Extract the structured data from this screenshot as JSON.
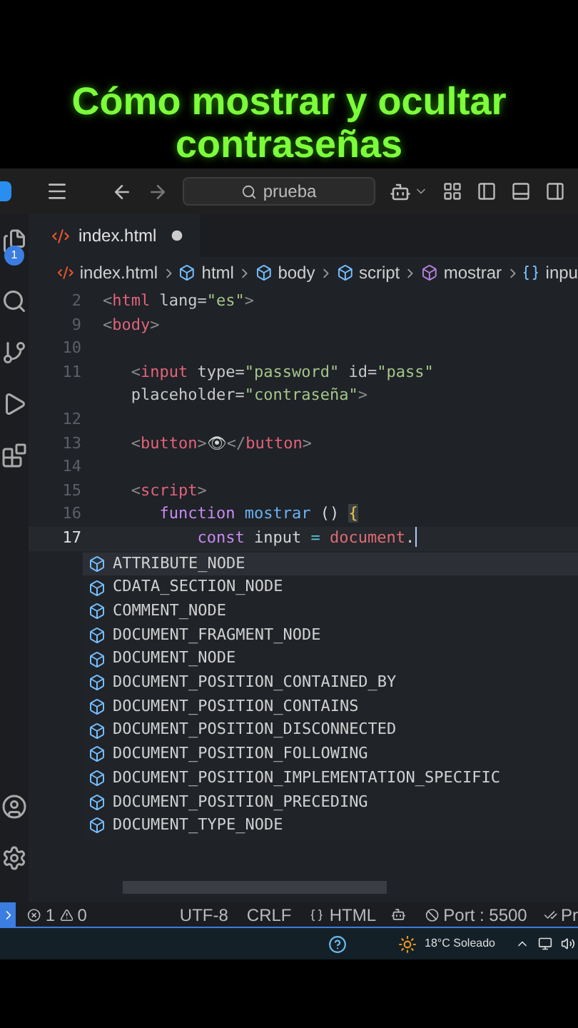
{
  "video_title": [
    "Cómo mostrar y ocultar",
    "contraseñas"
  ],
  "titlebar": {
    "search": "prueba"
  },
  "activity_badge": "1",
  "tabs": [
    {
      "label": "index.html",
      "selected": true,
      "modified": true
    }
  ],
  "breadcrumb": [
    {
      "kind": "file",
      "label": "index.html"
    },
    {
      "kind": "element",
      "label": "html"
    },
    {
      "kind": "element",
      "label": "body"
    },
    {
      "kind": "element",
      "label": "script"
    },
    {
      "kind": "function",
      "label": "mostrar"
    },
    {
      "kind": "variable",
      "label": "inpu"
    }
  ],
  "code": [
    {
      "number": "2",
      "current": false,
      "tokens": [
        {
          "kind": "punct",
          "text": "<"
        },
        {
          "kind": "tag",
          "text": "html"
        },
        {
          "kind": "attr",
          "text": " lang="
        },
        {
          "kind": "string",
          "text": "\"es\""
        },
        {
          "kind": "punct",
          "text": ">"
        }
      ]
    },
    {
      "number": "9",
      "current": false,
      "tokens": [
        {
          "kind": "punct",
          "text": "<"
        },
        {
          "kind": "tag",
          "text": "body"
        },
        {
          "kind": "punct",
          "text": ">"
        }
      ]
    },
    {
      "number": "10",
      "current": false
    },
    {
      "number": "11",
      "current": false,
      "tokens": [
        {
          "kind": "punct",
          "text": "   <"
        },
        {
          "kind": "tag",
          "text": "input"
        },
        {
          "kind": "attr",
          "text": " type="
        },
        {
          "kind": "string",
          "text": "\"password\""
        },
        {
          "kind": "attr",
          "text": " id="
        },
        {
          "kind": "string",
          "text": "\"pass\""
        }
      ]
    },
    {
      "current": false,
      "tokens": [
        {
          "kind": "attr",
          "text": "   placeholder="
        },
        {
          "kind": "string",
          "text": "\"contraseña\""
        },
        {
          "kind": "punct",
          "text": ">"
        }
      ]
    },
    {
      "number": "12",
      "current": false
    },
    {
      "number": "13",
      "current": false,
      "tokens": [
        {
          "kind": "punct",
          "text": "   <"
        },
        {
          "kind": "tag",
          "text": "button"
        },
        {
          "kind": "punct",
          "text": ">"
        },
        {
          "kind": "plain",
          "text": "👁"
        },
        {
          "kind": "punct",
          "text": "</"
        },
        {
          "kind": "tag",
          "text": "button"
        },
        {
          "kind": "punct",
          "text": ">"
        }
      ]
    },
    {
      "number": "14",
      "current": false
    },
    {
      "number": "15",
      "current": false,
      "tokens": [
        {
          "kind": "punct",
          "text": "   <"
        },
        {
          "kind": "tag",
          "text": "script"
        },
        {
          "kind": "punct",
          "text": ">"
        }
      ]
    },
    {
      "number": "16",
      "current": false,
      "tokens": [
        {
          "kind": "keyword",
          "text": "      function"
        },
        {
          "kind": "fn",
          "text": " mostrar"
        },
        {
          "kind": "plain",
          "text": " () "
        },
        {
          "kind": "brace",
          "text": "{"
        }
      ]
    },
    {
      "number": "17",
      "current": true,
      "tokens": [
        {
          "kind": "keyword",
          "text": "          const"
        },
        {
          "kind": "plain",
          "text": " input"
        },
        {
          "kind": "op",
          "text": " = "
        },
        {
          "kind": "object",
          "text": "document"
        },
        {
          "kind": "plain",
          "text": "."
        }
      ]
    }
  ],
  "suggestions": [
    {
      "label": "ATTRIBUTE_NODE",
      "selected": true
    },
    {
      "label": "CDATA_SECTION_NODE",
      "selected": false
    },
    {
      "label": "COMMENT_NODE",
      "selected": false
    },
    {
      "label": "DOCUMENT_FRAGMENT_NODE",
      "selected": false
    },
    {
      "label": "DOCUMENT_NODE",
      "selected": false
    },
    {
      "label": "DOCUMENT_POSITION_CONTAINED_BY",
      "selected": false
    },
    {
      "label": "DOCUMENT_POSITION_CONTAINS",
      "selected": false
    },
    {
      "label": "DOCUMENT_POSITION_DISCONNECTED",
      "selected": false
    },
    {
      "label": "DOCUMENT_POSITION_FOLLOWING",
      "selected": false
    },
    {
      "label": "DOCUMENT_POSITION_IMPLEMENTATION_SPECIFIC",
      "selected": false
    },
    {
      "label": "DOCUMENT_POSITION_PRECEDING",
      "selected": false
    },
    {
      "label": "DOCUMENT_TYPE_NODE",
      "selected": false
    }
  ],
  "status_bar": {
    "errors": "1",
    "warnings": "0",
    "encoding": "UTF-8",
    "line_ending": "CRLF",
    "language": "HTML",
    "port": "Port : 5500",
    "prettier": "Pr"
  },
  "taskbar": {
    "weather": "18°C  Soleado"
  }
}
